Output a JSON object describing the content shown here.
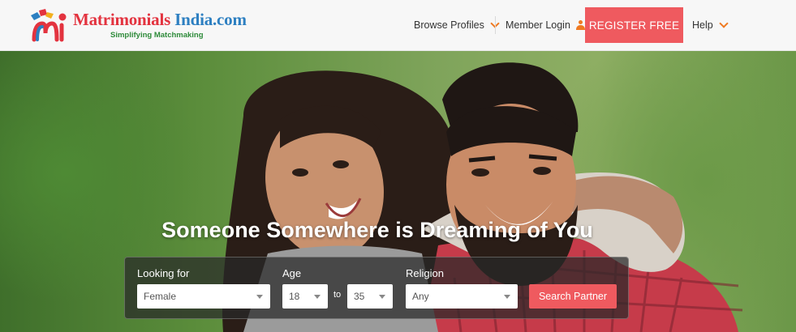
{
  "header": {
    "brand_part1": "Matrimonials",
    "brand_part2": " India.com",
    "tagline": "Simplifying Matchmaking",
    "nav": {
      "browse_profiles": "Browse Profiles",
      "member_login": "Member Login",
      "register": "REGISTER FREE",
      "help": "Help"
    }
  },
  "hero": {
    "headline": "Someone Somewhere is Dreaming of You",
    "photo_description": "smiling couple embracing outdoors"
  },
  "search": {
    "looking_for_label": "Looking for",
    "looking_for_value": "Female",
    "age_label": "Age",
    "age_from": "18",
    "age_to_label": "to",
    "age_to": "35",
    "religion_label": "Religion",
    "religion_value": "Any",
    "button": "Search Partner"
  },
  "colors": {
    "accent_red": "#ef5a5f",
    "brand_red": "#e3333f",
    "brand_blue": "#2d7fc1",
    "tagline_green": "#2e8b3a",
    "chevron_orange": "#ef7a22"
  }
}
